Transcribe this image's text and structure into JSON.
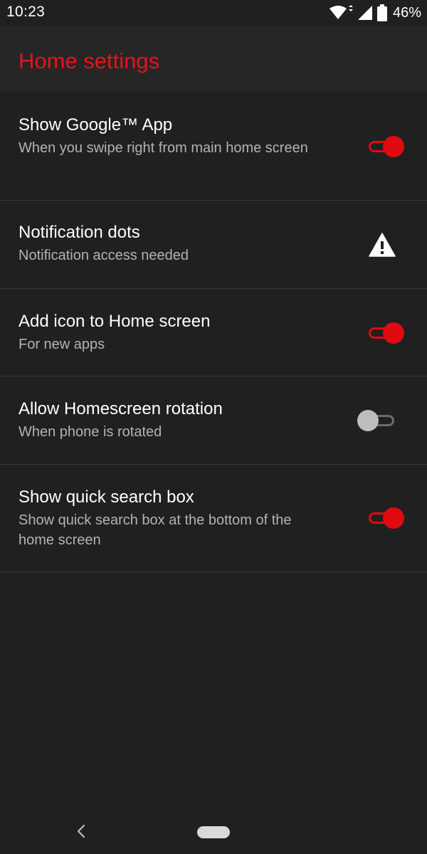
{
  "status_bar": {
    "time": "10:23",
    "battery_percent": "46%",
    "icons": [
      "wifi-icon",
      "signal-icon",
      "battery-icon"
    ]
  },
  "app_bar": {
    "title": "Home settings",
    "title_color": "#e8111c"
  },
  "settings": [
    {
      "title": "Show Google™ App",
      "summary": "When you swipe right from main home screen",
      "control": "switch",
      "checked": true
    },
    {
      "title": "Notification dots",
      "summary": "Notification access needed",
      "control": "warning-icon"
    },
    {
      "title": "Add icon to Home screen",
      "summary": "For new apps",
      "control": "switch",
      "checked": true
    },
    {
      "title": "Allow Homescreen rotation",
      "summary": "When phone is rotated",
      "control": "switch",
      "checked": false
    },
    {
      "title": "Show quick search box",
      "summary": "Show quick search box at the bottom of the home screen",
      "control": "switch",
      "checked": true
    }
  ],
  "colors": {
    "accent": "#e00a10",
    "background": "#202020",
    "summary_text": "#b3b3b3"
  },
  "nav_bar": {
    "icons": [
      "back-icon",
      "home-pill-icon"
    ]
  }
}
